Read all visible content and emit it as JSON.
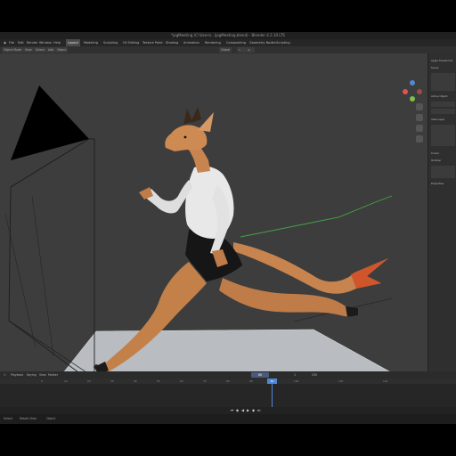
{
  "window": {
    "title": "*jogMeeting (C:\\Users\\...\\jogMeeting.blend) - Blender 4.2.10 LTS"
  },
  "menu": {
    "items": [
      "File",
      "Edit",
      "Render",
      "Window",
      "Help"
    ]
  },
  "workspace_tabs": [
    {
      "label": "Layout",
      "active": true
    },
    {
      "label": "Modeling",
      "active": false
    },
    {
      "label": "Sculpting",
      "active": false
    },
    {
      "label": "UV Editing",
      "active": false
    },
    {
      "label": "Texture Paint",
      "active": false
    },
    {
      "label": "Shading",
      "active": false
    },
    {
      "label": "Animation",
      "active": false
    },
    {
      "label": "Rendering",
      "active": false
    },
    {
      "label": "Compositing",
      "active": false
    },
    {
      "label": "Geometry Nodes",
      "active": false
    },
    {
      "label": "Scripting",
      "active": false
    }
  ],
  "viewport_header": {
    "mode": "Object Mode",
    "view": "View",
    "select": "Select",
    "add": "Add",
    "object": "Object",
    "transform": "Global"
  },
  "gizmo": {
    "axis_colors": {
      "x": "#e0544d",
      "y": "#7ec04a",
      "z": "#4f88d8"
    }
  },
  "npanel": {
    "sections": [
      "Apply Transforms",
      "Scene",
      "Active Object",
      "View Layer",
      "Cursor",
      "Outliner",
      "Properties"
    ]
  },
  "timeline": {
    "menus": [
      "Playback",
      "Keying",
      "View",
      "Marker"
    ],
    "current_frame": "60",
    "start": "1",
    "end": "250",
    "ticks": [
      "0",
      "10",
      "20",
      "30",
      "40",
      "50",
      "60",
      "70",
      "80",
      "90",
      "100",
      "110",
      "120"
    ]
  },
  "statusbar": {
    "left": "Select",
    "mid": "Rotate View",
    "right": "Object"
  },
  "colors": {
    "viewport_bg": "#3d3d3d",
    "accent": "#4f88d8",
    "floor": "#b9bcc0"
  }
}
